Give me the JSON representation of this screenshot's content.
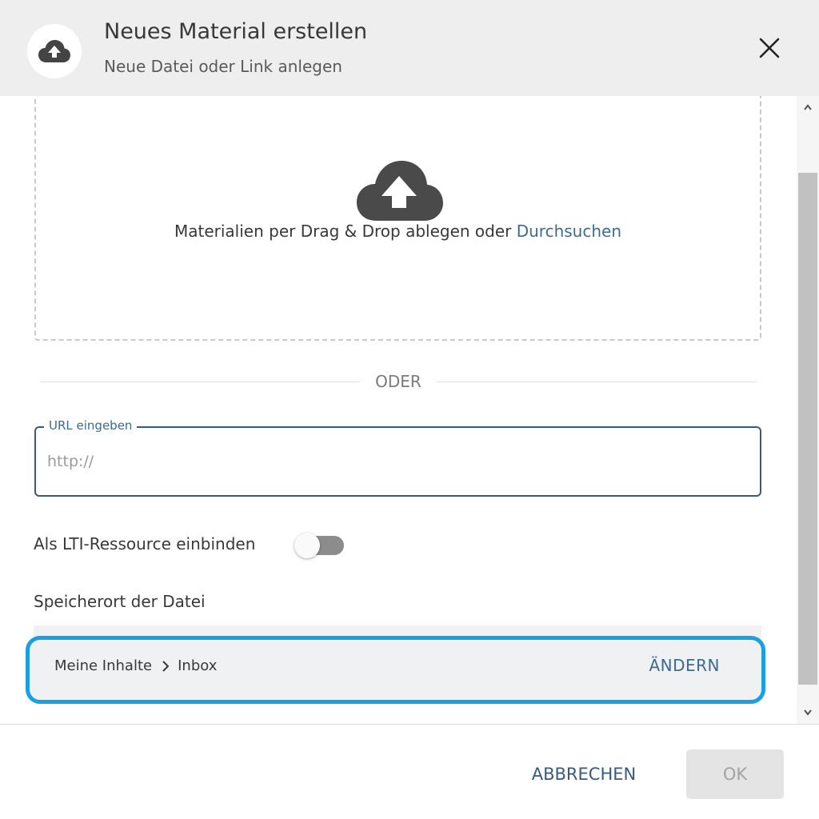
{
  "dialog": {
    "title": "Neues Material erstellen",
    "subtitle": "Neue Datei oder Link anlegen",
    "header_icon": "cloud-upload-icon",
    "close_icon": "close-icon"
  },
  "dropzone": {
    "icon": "cloud-upload-icon",
    "text": "Materialien per Drag & Drop ablegen oder ",
    "browse_link": "Durchsuchen"
  },
  "separator": {
    "text": "ODER"
  },
  "url_field": {
    "label": "URL eingeben",
    "placeholder": "http://",
    "value": ""
  },
  "lti": {
    "label": "Als LTI-Ressource einbinden",
    "enabled": false
  },
  "location": {
    "heading": "Speicherort der Datei",
    "path": [
      "Meine Inhalte",
      "Inbox"
    ],
    "separator_icon": "chevron-right-icon",
    "change_label": "ÄNDERN"
  },
  "footer": {
    "cancel_label": "ABBRECHEN",
    "ok_label": "OK",
    "ok_disabled": true
  },
  "colors": {
    "accent": "#3d6a8f",
    "highlight_border": "#1aa0e0",
    "header_bg": "#eeeeee"
  }
}
